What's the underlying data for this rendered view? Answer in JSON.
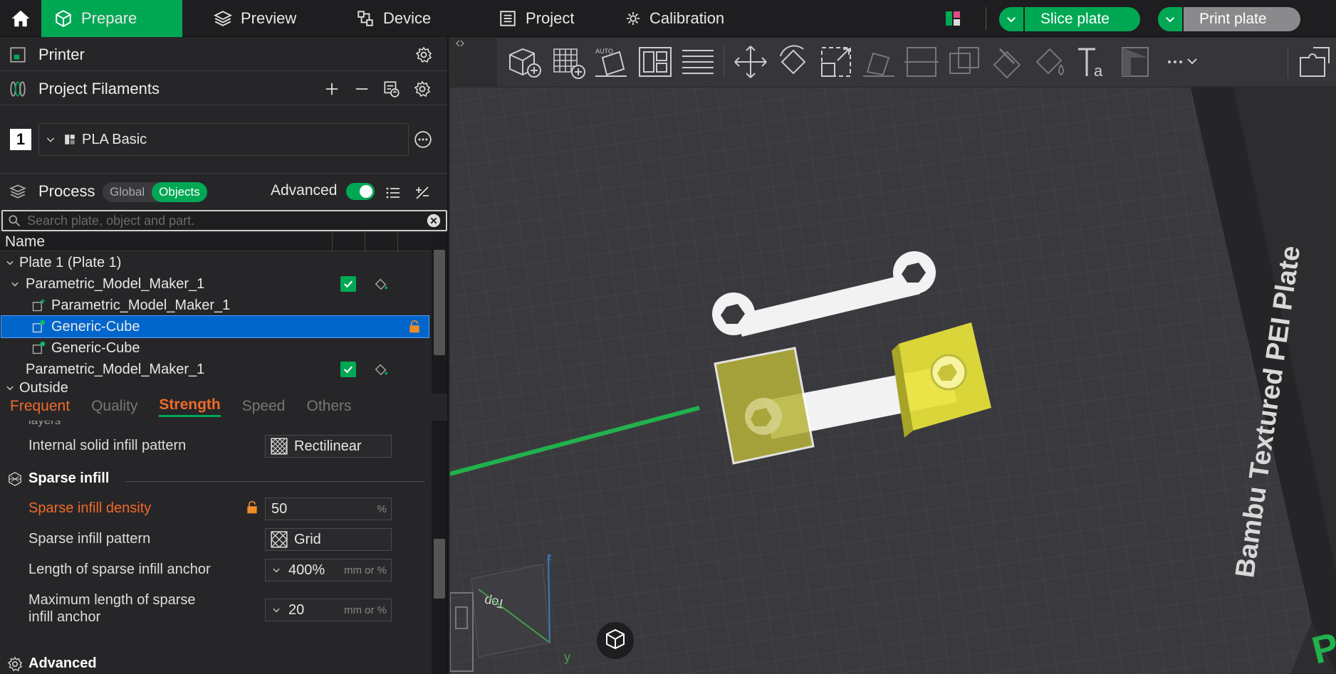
{
  "topbar": {
    "tabs": [
      {
        "label": "Prepare",
        "icon": "cube-icon"
      },
      {
        "label": "Preview",
        "icon": "layers-icon"
      },
      {
        "label": "Device",
        "icon": "device-icon"
      },
      {
        "label": "Project",
        "icon": "project-icon"
      },
      {
        "label": "Calibration",
        "icon": "calibration-icon"
      }
    ],
    "slice_label": "Slice plate",
    "print_label": "Print plate",
    "colors": {
      "accent": "#00a854",
      "bar": "#1e1e20"
    }
  },
  "printer": {
    "title": "Printer"
  },
  "filaments": {
    "title": "Project Filaments",
    "slot": "1",
    "name": "PLA Basic"
  },
  "process": {
    "title": "Process",
    "seg_global": "Global",
    "seg_objects": "Objects",
    "advanced_label": "Advanced",
    "search_placeholder": "Search plate, object and part."
  },
  "tree": {
    "name_header": "Name",
    "rows": [
      {
        "label": "Plate 1 (Plate 1)"
      },
      {
        "label": "Parametric_Model_Maker_1"
      },
      {
        "label": "Parametric_Model_Maker_1"
      },
      {
        "label": "Generic-Cube"
      },
      {
        "label": "Generic-Cube"
      },
      {
        "label": "Parametric_Model_Maker_1"
      },
      {
        "label": "Outside"
      }
    ]
  },
  "settings_tabs": [
    "Frequent",
    "Quality",
    "Strength",
    "Speed",
    "Others"
  ],
  "settings": {
    "cut_label": "layers",
    "internal_solid_pattern": {
      "label": "Internal solid infill pattern",
      "value": "Rectilinear"
    },
    "sparse_section": "Sparse infill",
    "density": {
      "label": "Sparse infill density",
      "value": "50",
      "unit": "%"
    },
    "pattern": {
      "label": "Sparse infill pattern",
      "value": "Grid"
    },
    "anchor": {
      "label": "Length of sparse infill anchor",
      "value": "400%",
      "unit": "mm or %"
    },
    "max_anchor": {
      "label_line1": "Maximum length of sparse",
      "label_line2": "infill anchor",
      "value": "20",
      "unit": "mm or %"
    },
    "advanced_section": "Advanced"
  },
  "viewport": {
    "plate_label": "Bambu Textured PEI Plate",
    "plate_label_corner": "Plate",
    "cube_face": "Top",
    "axis_z": "z",
    "axis_y": "y",
    "auto_label": "AUTO",
    "colors": {
      "plate": "#3a3a3e",
      "grid": "#4a4a4f",
      "highlight": "#c8c23a",
      "arrow": "#22b14c"
    }
  }
}
